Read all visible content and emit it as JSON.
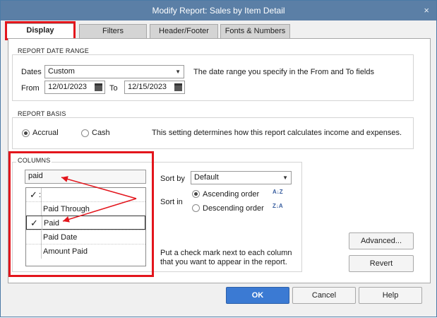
{
  "window": {
    "title": "Modify Report: Sales by Item Detail",
    "close_glyph": "×"
  },
  "tabs": [
    {
      "label": "Display",
      "active": true
    },
    {
      "label": "Filters"
    },
    {
      "label": "Header/Footer"
    },
    {
      "label": "Fonts & Numbers"
    }
  ],
  "date_range": {
    "title": "REPORT DATE RANGE",
    "dates_label": "Dates",
    "dates_value": "Custom",
    "description": "The date range you specify in the From and To fields",
    "from_label": "From",
    "from_value": "12/01/2023",
    "to_label": "To",
    "to_value": "12/15/2023"
  },
  "basis": {
    "title": "REPORT BASIS",
    "accrual_label": "Accrual",
    "cash_label": "Cash",
    "selected": "Accrual",
    "description": "This setting determines how this report calculates income and expenses."
  },
  "columns": {
    "title": "COLUMNS",
    "search_value": "paid",
    "header_check": "✓",
    "header_text": ":",
    "items": [
      {
        "label": "Paid Through",
        "checked": false
      },
      {
        "label": "Paid",
        "checked": true
      },
      {
        "label": "Paid Date",
        "checked": false
      },
      {
        "label": "Amount Paid",
        "checked": false
      }
    ],
    "check_glyph": "✓"
  },
  "sort": {
    "sort_by_label": "Sort by",
    "sort_by_value": "Default",
    "sort_in_label": "Sort in",
    "ascending_label": "Ascending order",
    "descending_label": "Descending order",
    "selected": "Ascending order",
    "ascending_icon_text": "A↓Z",
    "descending_icon_text": "Z↓A",
    "hint": "Put a check mark next to each column that you want to appear in the report."
  },
  "buttons": {
    "advanced": "Advanced...",
    "revert": "Revert",
    "ok": "OK",
    "cancel": "Cancel",
    "help": "Help"
  },
  "colors": {
    "titlebar": "#5b7fa6",
    "highlight": "#e3151c",
    "primary_button": "#3b7ad3"
  }
}
